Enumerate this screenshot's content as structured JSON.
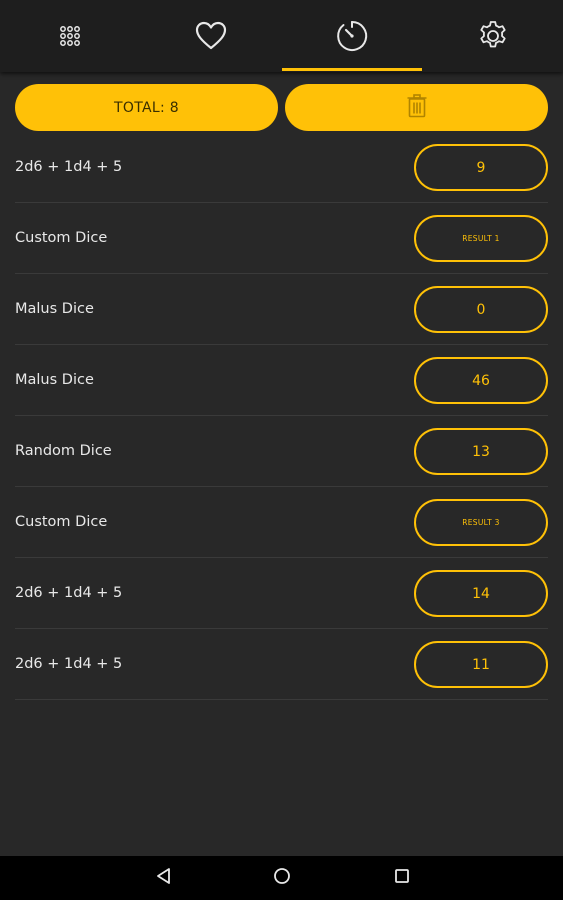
{
  "tabs": [
    {
      "icon": "dice-grid-icon"
    },
    {
      "icon": "heart-icon"
    },
    {
      "icon": "history-timer-icon",
      "selected": true
    },
    {
      "icon": "gear-icon"
    }
  ],
  "accent_color": "#ffc107",
  "actions": {
    "total_label": "TOTAL: 8",
    "delete_icon": "trash-icon"
  },
  "history": [
    {
      "label": "2d6  + 1d4  + 5",
      "result": "9"
    },
    {
      "label": "Custom Dice",
      "result": "RESULT 1"
    },
    {
      "label": "Malus Dice",
      "result": "0"
    },
    {
      "label": "Malus Dice",
      "result": "46"
    },
    {
      "label": "Random Dice",
      "result": "13"
    },
    {
      "label": "Custom Dice",
      "result": "RESULT 3"
    },
    {
      "label": "2d6  + 1d4  + 5",
      "result": "14"
    },
    {
      "label": "2d6  + 1d4  + 5",
      "result": "11"
    }
  ],
  "system_nav": [
    "back-icon",
    "home-icon",
    "recents-icon"
  ]
}
